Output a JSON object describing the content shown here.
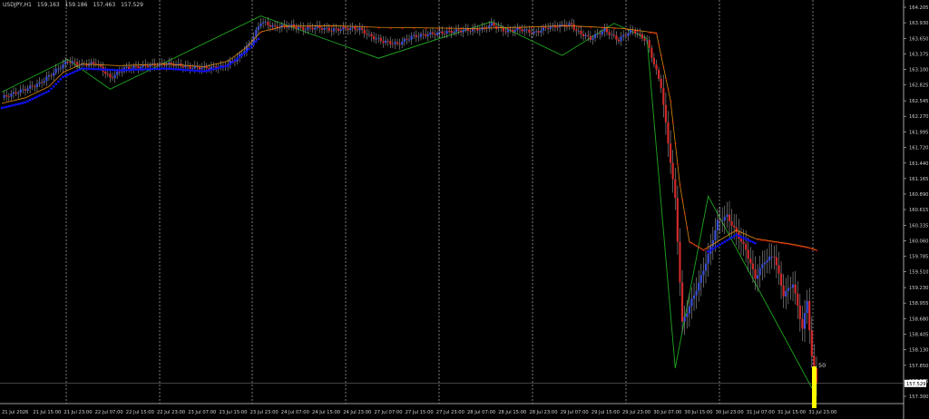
{
  "header": {
    "symbol": "USDJPY,H1",
    "open": "159.163",
    "high": "159.186",
    "low": "157.463",
    "close": "157.529"
  },
  "colors": {
    "background": "#000000",
    "grid": "#cfcfcf",
    "axis_text": "#d0d0d0",
    "bull_body": "#3a4fd6",
    "bear_body": "#d12a2a",
    "wick": "#9a9a9a",
    "ma_bull": "#1010ff",
    "ma_bear": "#ff1010",
    "ma_line": "#e08a10",
    "zigzag": "#1fa81f",
    "bar_indicator": "#ffff00"
  },
  "chart_data": {
    "type": "candlestick",
    "price_axis_ticks": [
      "164.205",
      "163.930",
      "163.650",
      "163.375",
      "163.100",
      "162.825",
      "162.545",
      "162.270",
      "161.995",
      "161.720",
      "161.440",
      "161.165",
      "160.890",
      "160.615",
      "160.335",
      "160.060",
      "159.785",
      "159.510",
      "159.230",
      "158.955",
      "158.680",
      "158.405",
      "158.130",
      "157.850",
      "157.575",
      "157.300"
    ],
    "ylim": [
      157.3,
      164.205
    ],
    "current_price": "157.529",
    "time_axis_labels": [
      "21 Jul 2026",
      "21 Jul 15:00",
      "21 Jul 23:00",
      "22 Jul 07:00",
      "22 Jul 15:00",
      "22 Jul 23:00",
      "23 Jul 07:00",
      "23 Jul 15:00",
      "23 Jul 23:00",
      "24 Jul 07:00",
      "24 Jul 15:00",
      "24 Jul 23:00",
      "27 Jul 07:00",
      "27 Jul 15:00",
      "27 Jul 23:00",
      "28 Jul 07:00",
      "28 Jul 15:00",
      "28 Jul 23:00",
      "29 Jul 07:00",
      "29 Jul 15:00",
      "29 Jul 23:00",
      "30 Jul 07:00",
      "30 Jul 15:00",
      "30 Jul 23:00",
      "31 Jul 07:00",
      "31 Jul 15:00",
      "31 Jul 23:00"
    ],
    "indicator_label": "50",
    "indicator_value": 50,
    "grid": "vertical-dotted",
    "close_path": [
      [
        0,
        162.6
      ],
      [
        8,
        162.72
      ],
      [
        16,
        162.85
      ],
      [
        22,
        163.05
      ],
      [
        28,
        163.25
      ],
      [
        34,
        163.18
      ],
      [
        40,
        163.22
      ],
      [
        46,
        162.95
      ],
      [
        52,
        163.12
      ],
      [
        58,
        163.15
      ],
      [
        64,
        163.18
      ],
      [
        72,
        163.2
      ],
      [
        80,
        163.14
      ],
      [
        88,
        163.13
      ],
      [
        94,
        163.15
      ],
      [
        100,
        163.3
      ],
      [
        106,
        163.6
      ],
      [
        110,
        163.95
      ],
      [
        116,
        163.85
      ],
      [
        122,
        163.88
      ],
      [
        128,
        163.82
      ],
      [
        134,
        163.85
      ],
      [
        140,
        163.8
      ],
      [
        146,
        163.83
      ],
      [
        152,
        163.82
      ],
      [
        156,
        163.7
      ],
      [
        162,
        163.6
      ],
      [
        168,
        163.55
      ],
      [
        174,
        163.68
      ],
      [
        180,
        163.72
      ],
      [
        186,
        163.75
      ],
      [
        192,
        163.78
      ],
      [
        198,
        163.8
      ],
      [
        204,
        163.82
      ],
      [
        208,
        163.9
      ],
      [
        214,
        163.78
      ],
      [
        220,
        163.82
      ],
      [
        226,
        163.75
      ],
      [
        232,
        163.85
      ],
      [
        238,
        163.88
      ],
      [
        242,
        163.9
      ],
      [
        244,
        163.78
      ],
      [
        250,
        163.65
      ],
      [
        256,
        163.8
      ],
      [
        262,
        163.62
      ],
      [
        264,
        163.7
      ],
      [
        268,
        163.8
      ],
      [
        274,
        163.6
      ],
      [
        280,
        162.8
      ],
      [
        286,
        160.8
      ],
      [
        289,
        158.6
      ],
      [
        292,
        158.9
      ],
      [
        296,
        159.3
      ],
      [
        300,
        159.8
      ],
      [
        304,
        160.4
      ],
      [
        308,
        160.5
      ],
      [
        312,
        160.2
      ],
      [
        316,
        159.9
      ],
      [
        320,
        159.4
      ],
      [
        324,
        159.7
      ],
      [
        328,
        159.8
      ],
      [
        332,
        159.1
      ],
      [
        336,
        159.3
      ],
      [
        340,
        158.5
      ],
      [
        342,
        159.0
      ],
      [
        344,
        158.0
      ],
      [
        346,
        157.55
      ]
    ],
    "ma_path": [
      [
        0,
        162.45
      ],
      [
        10,
        162.55
      ],
      [
        20,
        162.75
      ],
      [
        26,
        163.0
      ],
      [
        34,
        163.15
      ],
      [
        50,
        163.12
      ],
      [
        70,
        163.15
      ],
      [
        86,
        163.1
      ],
      [
        96,
        163.2
      ],
      [
        104,
        163.45
      ],
      [
        110,
        163.72
      ],
      [
        120,
        163.82
      ],
      [
        140,
        163.83
      ],
      [
        160,
        163.8
      ],
      [
        200,
        163.78
      ],
      [
        220,
        163.8
      ],
      [
        240,
        163.83
      ],
      [
        264,
        163.78
      ],
      [
        278,
        163.7
      ],
      [
        284,
        162.5
      ],
      [
        288,
        161.0
      ],
      [
        292,
        160.0
      ],
      [
        298,
        159.85
      ],
      [
        304,
        160.0
      ],
      [
        312,
        160.2
      ],
      [
        320,
        160.05
      ],
      [
        328,
        160.0
      ],
      [
        336,
        159.95
      ],
      [
        342,
        159.9
      ],
      [
        346,
        159.85
      ]
    ],
    "zigzag_path": [
      [
        0,
        162.7
      ],
      [
        28,
        163.28
      ],
      [
        46,
        162.75
      ],
      [
        110,
        164.05
      ],
      [
        160,
        163.3
      ],
      [
        208,
        163.95
      ],
      [
        238,
        163.35
      ],
      [
        260,
        163.92
      ],
      [
        274,
        163.65
      ],
      [
        286,
        157.8
      ],
      [
        300,
        160.85
      ],
      [
        344,
        157.45
      ]
    ],
    "x_range": [
      0,
      346
    ]
  }
}
